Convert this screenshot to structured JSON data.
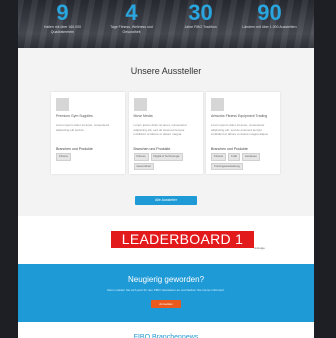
{
  "stats": [
    {
      "number": "9",
      "label": "Hallen mit über 160.000 Quadratmetern"
    },
    {
      "number": "4",
      "label": "Tage Fitness, Wellness und Gesundheit"
    },
    {
      "number": "30",
      "label": "Jahre FIBO Tradition"
    },
    {
      "number": "90",
      "label": "Ländern mit über 1.000 Ausstellern"
    }
  ],
  "exhibitors": {
    "title": "Unsere Aussteller",
    "cards": [
      {
        "name": "Premium Gym Supplies",
        "description": "Lorem ipsum dolor sit amet, consectetur adipiscing elit sed do.",
        "categories_label": "Branchen und Produkte",
        "tags": [
          "Fitness"
        ]
      },
      {
        "name": "Move Media",
        "description": "Lorem ipsum dolor sit amet, consectetur adipiscing elit, sed do eiusmod tempor incididunt ut labore et dolore magna.",
        "categories_label": "Branchen und Produkte",
        "tags": [
          "Fitness",
          "Digital & Technologie",
          "Gesundheit"
        ]
      },
      {
        "name": "Artworks Fitness Equipment Trading",
        "description": "Lorem ipsum dolor sit amet, consectetur adipiscing elit, sed do eiusmod tempor incididunt ut labore et dolore magna aliqua.",
        "categories_label": "Branchen und Produkte",
        "tags": [
          "Fitness",
          "Kraft",
          "Ausdauer",
          "Trainingsausstattung"
        ]
      }
    ],
    "button_label": "Alle Aussteller"
  },
  "ad": {
    "text": "LEADERBOARD 1",
    "mark": "Anzeige"
  },
  "cta": {
    "title": "Neugierig geworden?",
    "subtitle": "Dann melden Sie sich jetzt für den FIBO Newsletter an und bleiben Sie immer informiert.",
    "button_label": "Anmelden"
  },
  "news": {
    "title": "FIBO Branchennews"
  },
  "colors": {
    "accent": "#1e9ad6",
    "ad_red": "#e31a1c",
    "cta_button": "#ea5a1f"
  }
}
